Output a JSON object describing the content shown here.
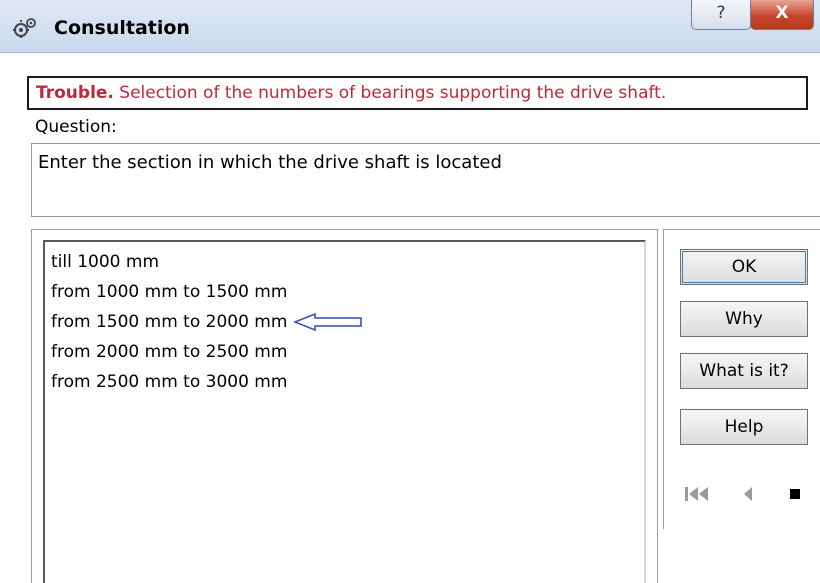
{
  "window": {
    "title": "Consultation",
    "icon": "consultation-app-icon",
    "caption_buttons": {
      "help_label": "?",
      "close_label": "X"
    }
  },
  "trouble": {
    "label": "Trouble.",
    "text": "Selection of the numbers of bearings supporting the drive shaft."
  },
  "question": {
    "label": "Question:",
    "text": "Enter the section in which the drive shaft is located"
  },
  "answers": [
    {
      "label": "till 1000 mm"
    },
    {
      "label": "from 1000 mm to 1500 mm"
    },
    {
      "label": "from 1500 mm to 2000 mm",
      "arrow_marker": true
    },
    {
      "label": "from 2000 mm to 2500 mm"
    },
    {
      "label": "from 2500 mm to 3000 mm"
    }
  ],
  "buttons": {
    "ok": "OK",
    "why": "Why",
    "what_is_it": "What is it?",
    "help": "Help"
  },
  "navigation": {
    "first_icon": "skip-to-first-icon",
    "prev_icon": "previous-icon",
    "stop_icon": "stop-icon"
  },
  "colors": {
    "trouble_text": "#c0283a",
    "arrow_outline": "#3a4fb0",
    "close_button": "#c7452c"
  }
}
